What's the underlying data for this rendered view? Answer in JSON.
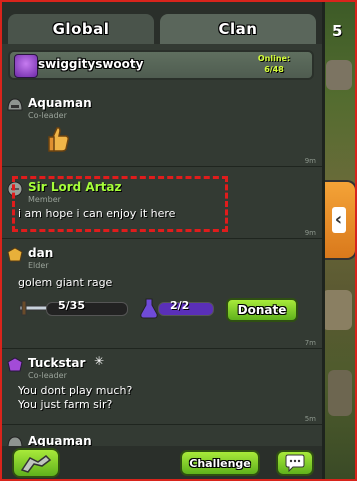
{
  "tabs": {
    "global": "Global",
    "clan": "Clan"
  },
  "clan": {
    "name": "swiggityswooty",
    "online_label": "Online:",
    "online_count": "6/48"
  },
  "game": {
    "top_right_number": "5"
  },
  "messages": [
    {
      "name": "Aquaman",
      "role": "Co-leader",
      "text": "",
      "time": "9m",
      "name_color": "#ffffff"
    },
    {
      "name": "Sir Lord Artaz",
      "role": "Member",
      "text": "i am hope i can enjoy it here",
      "time": "9m",
      "name_color": "#a6ff3a"
    },
    {
      "name": "dan",
      "role": "Elder",
      "text": "golem giant rage",
      "time": "7m",
      "name_color": "#ffffff",
      "troops": "5/35",
      "spells": "2/2",
      "donate_label": "Donate"
    },
    {
      "name": "Tuckstar",
      "role": "Co-leader",
      "text_line1": "You dont play much?",
      "text_line2": "You just farm sir?",
      "time": "5m",
      "name_color": "#ffffff"
    },
    {
      "name": "Aquaman",
      "role": "",
      "name_color": "#ffffff"
    }
  ],
  "bottom": {
    "challenge_label": "Challenge"
  },
  "icons": {
    "war": "war-icon",
    "chat": "chat-bubble-icon",
    "collapse": "chevron-left-icon",
    "thumbs": "thumbs-up-icon"
  },
  "colors": {
    "accent_green": "#5fb11c",
    "highlight_red": "#e01c1c",
    "tab_orange": "#f4a337"
  }
}
